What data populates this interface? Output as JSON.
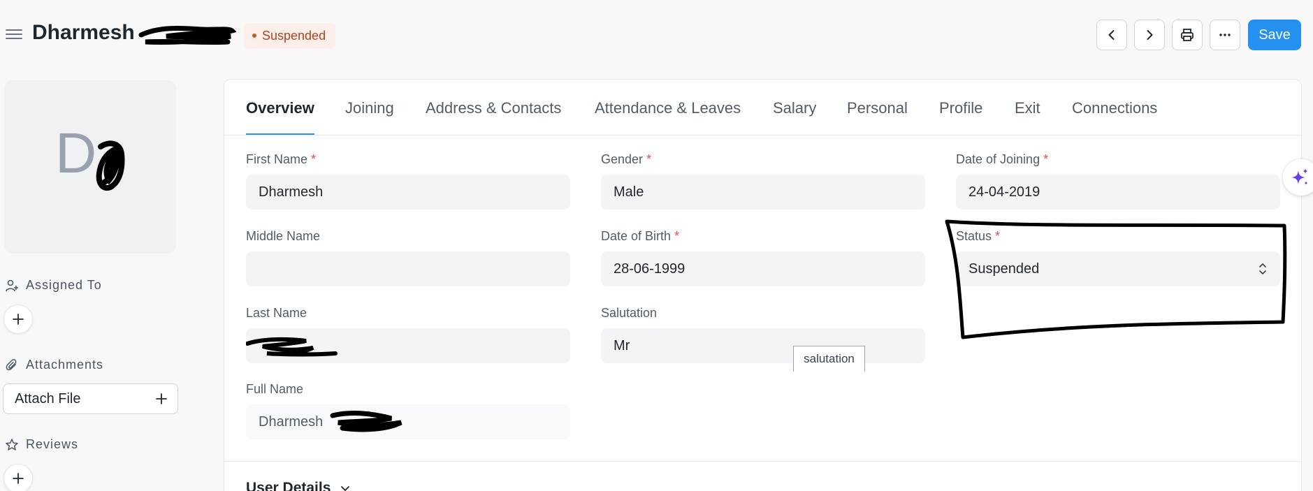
{
  "header": {
    "title": "Dharmesh",
    "status": "Suspended",
    "save_label": "Save",
    "colors": {
      "primary": "#2490ef",
      "badge_bg": "#fdf0ea",
      "badge_text": "#b0441e"
    }
  },
  "sidebar": {
    "avatar_letter": "D",
    "assigned_to_label": "Assigned To",
    "attachments_label": "Attachments",
    "attach_file_label": "Attach File",
    "reviews_label": "Reviews"
  },
  "tabs": [
    {
      "label": "Overview",
      "active": true
    },
    {
      "label": "Joining"
    },
    {
      "label": "Address & Contacts"
    },
    {
      "label": "Attendance & Leaves"
    },
    {
      "label": "Salary"
    },
    {
      "label": "Personal"
    },
    {
      "label": "Profile"
    },
    {
      "label": "Exit"
    },
    {
      "label": "Connections"
    }
  ],
  "fields": {
    "first_name": {
      "label": "First Name",
      "required": "*",
      "value": "Dharmesh"
    },
    "middle_name": {
      "label": "Middle Name",
      "value": ""
    },
    "last_name": {
      "label": "Last Name",
      "value": ""
    },
    "full_name": {
      "label": "Full Name",
      "value": "Dharmesh"
    },
    "gender": {
      "label": "Gender",
      "required": "*",
      "value": "Male"
    },
    "date_of_birth": {
      "label": "Date of Birth",
      "required": "*",
      "value": "28-06-1999"
    },
    "salutation": {
      "label": "Salutation",
      "value": "Mr",
      "tooltip": "salutation"
    },
    "date_of_joining": {
      "label": "Date of Joining",
      "required": "*",
      "value": "24-04-2019"
    },
    "status": {
      "label": "Status",
      "required": "*",
      "value": "Suspended"
    }
  },
  "sections": {
    "user_details": "User Details"
  }
}
